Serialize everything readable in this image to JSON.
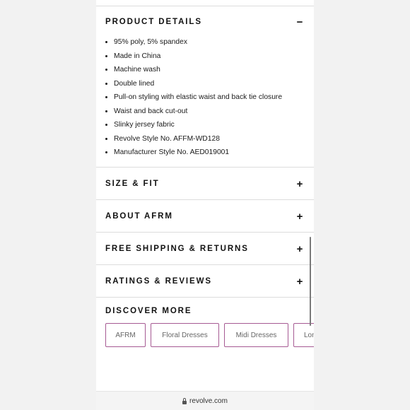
{
  "sections": {
    "product_details": {
      "title": "PRODUCT DETAILS",
      "toggle": "−",
      "items": [
        "95% poly, 5% spandex",
        "Made in China",
        "Machine wash",
        "Double lined",
        "Pull-on styling with elastic waist and back tie closure",
        "Waist and back cut-out",
        "Slinky jersey fabric",
        "Revolve Style No. AFFM-WD128",
        "Manufacturer Style No. AED019001"
      ]
    },
    "size_fit": {
      "title": "SIZE & FIT",
      "toggle": "+"
    },
    "about": {
      "title": "ABOUT AFRM",
      "toggle": "+"
    },
    "shipping": {
      "title": "FREE SHIPPING & RETURNS",
      "toggle": "+"
    },
    "reviews": {
      "title": "RATINGS & REVIEWS",
      "toggle": "+"
    }
  },
  "discover": {
    "title": "DISCOVER MORE",
    "chips": [
      "AFRM",
      "Floral Dresses",
      "Midi Dresses",
      "Lon"
    ]
  },
  "browser": {
    "url": "revolve.com"
  },
  "colors": {
    "chip_border": "#a65a93",
    "divider": "#dcdcdc"
  }
}
